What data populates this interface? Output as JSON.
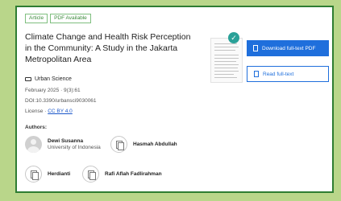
{
  "badges": [
    "Article",
    "PDF Available"
  ],
  "title": "Climate Change and Health Risk Perception in the Community: A Study in the Jakarta Metropolitan Area",
  "journal": "Urban Science",
  "meta": {
    "date": "February 2025 · 9(3):61",
    "doi": "DOI:10.3390/urbansci9030061",
    "license_label": "License ·",
    "license_link": "CC BY 4.0"
  },
  "authors_heading": "Authors:",
  "authors": [
    {
      "name": "Dewi Susanna",
      "affiliation": "University of Indonesia"
    },
    {
      "name": "Hasmah Abdullah",
      "affiliation": ""
    },
    {
      "name": "Herdianti",
      "affiliation": ""
    },
    {
      "name": "Rafi Aflah Fadlirahman",
      "affiliation": ""
    }
  ],
  "buttons": {
    "download": "Download full-text PDF",
    "read": "Read full-text"
  },
  "colors": {
    "background": "#b9d68a",
    "border": "#2e7d32",
    "primary": "#1f6fdc",
    "check": "#2aa198"
  },
  "icons": {
    "check": "✓"
  }
}
